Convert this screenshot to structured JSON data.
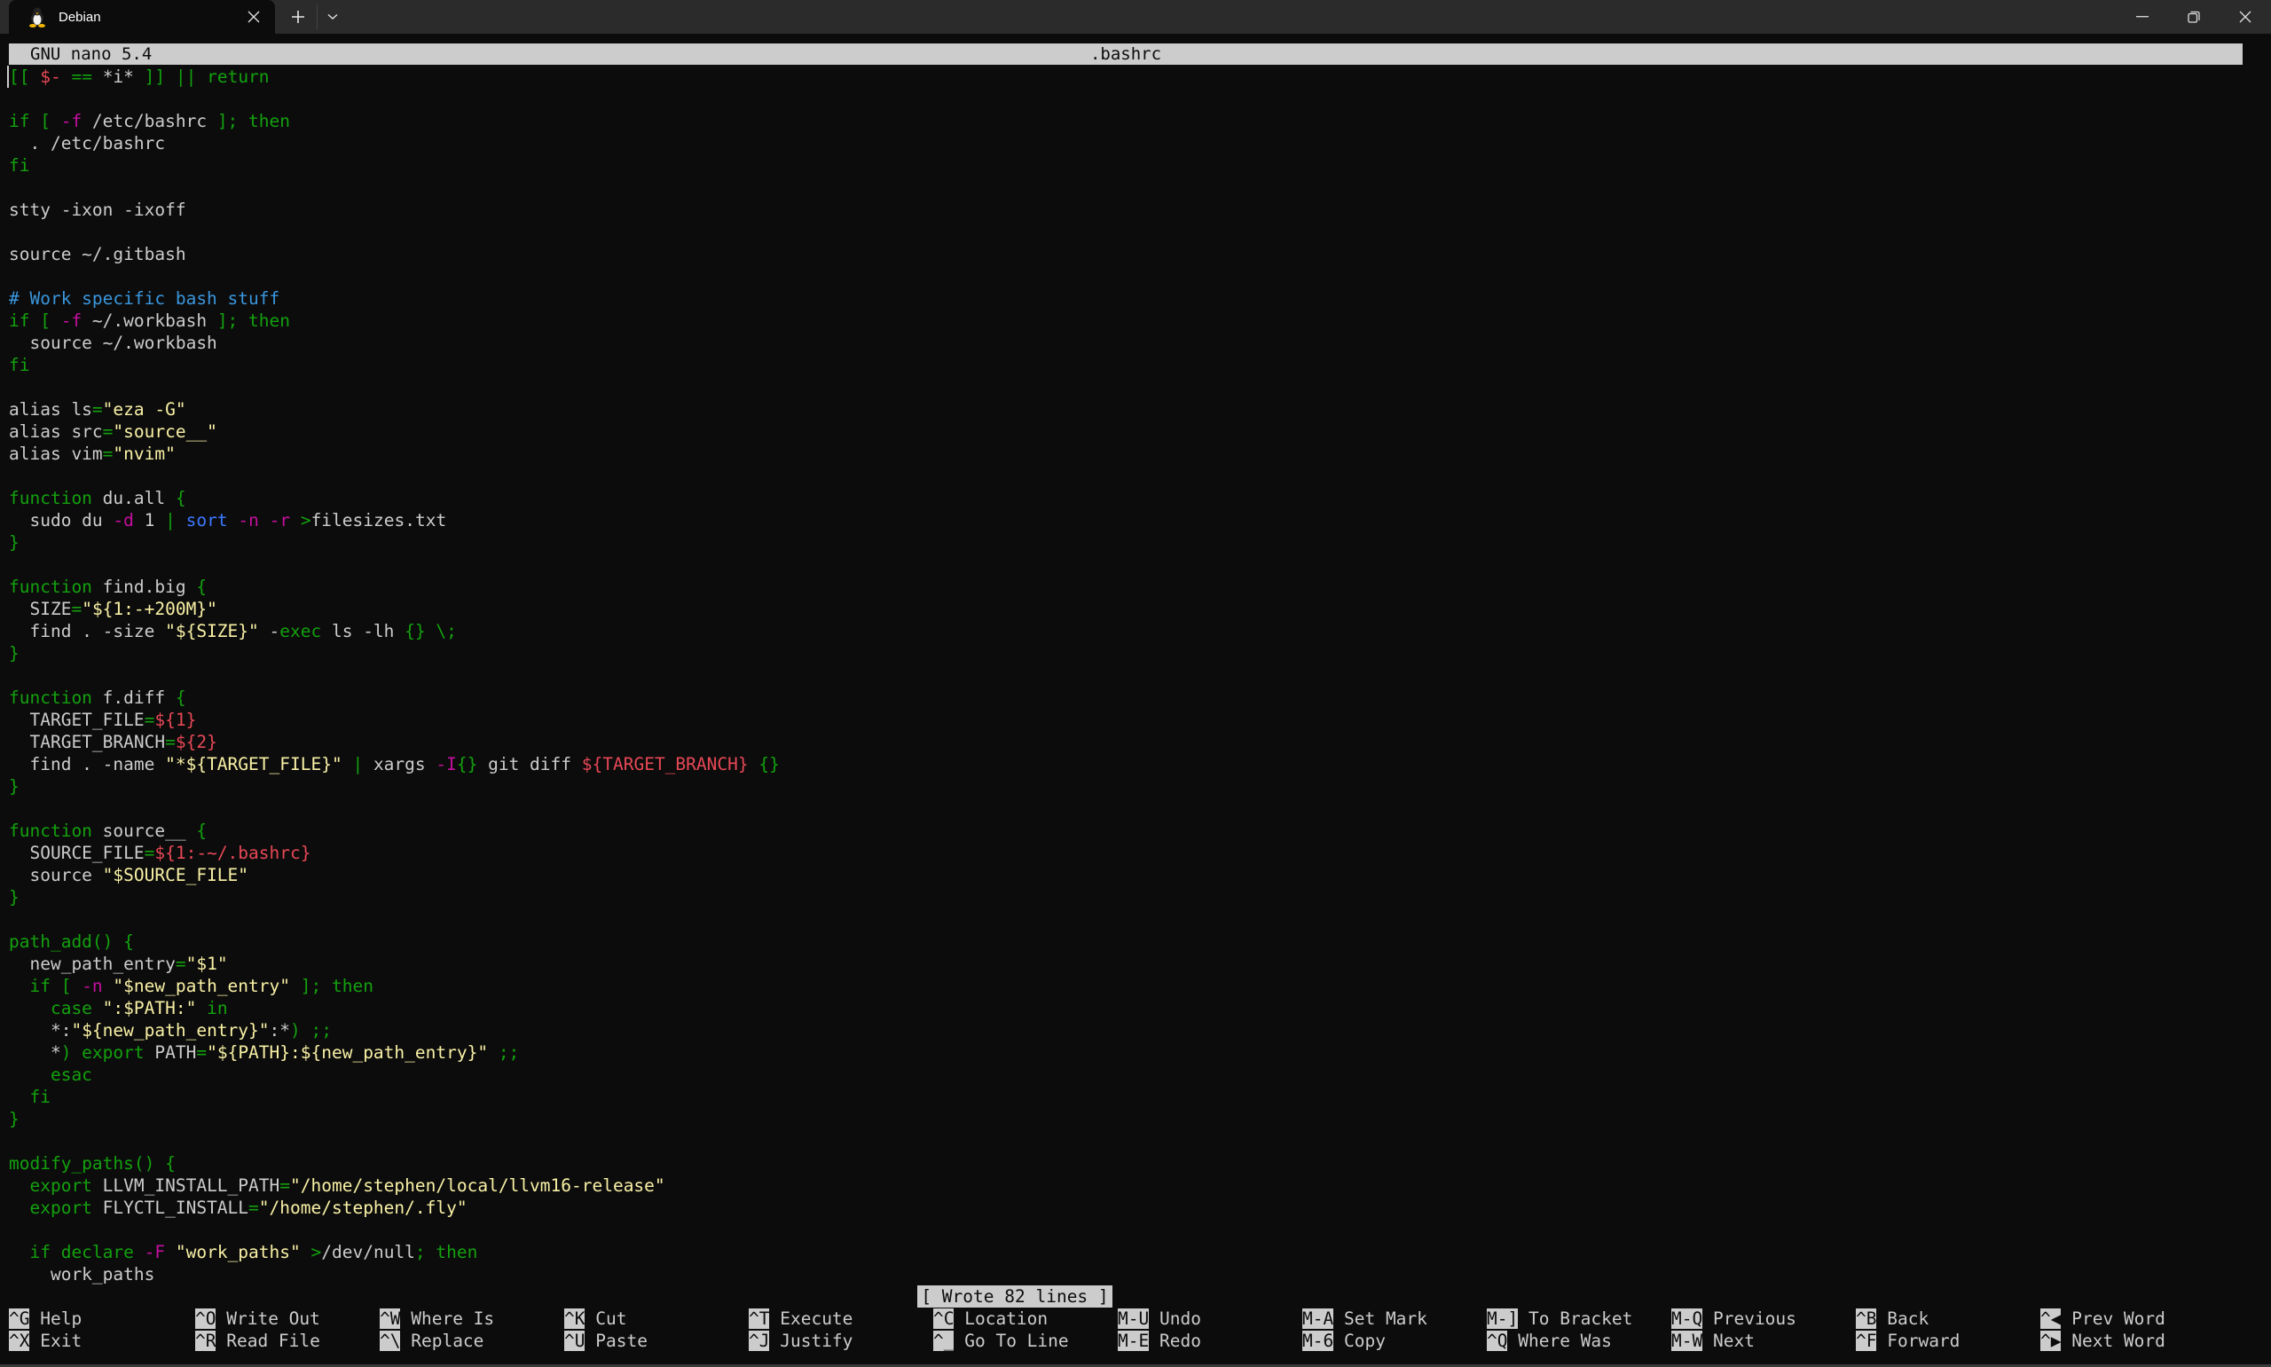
{
  "window": {
    "tab_title": "Debian",
    "tab_icon": "tux-penguin-icon",
    "new_tab_label": "+",
    "dropdown_label": "⌄",
    "controls": [
      "minimize",
      "maximize",
      "close"
    ]
  },
  "nano": {
    "version": "GNU nano 5.4",
    "filename": ".bashrc",
    "status_message": "[ Wrote 82 lines ]"
  },
  "code_lines": [
    [
      [
        "kw",
        "[[ "
      ],
      [
        "var",
        "$-"
      ],
      [
        "kw",
        " == "
      ],
      [
        "plain",
        "*i*"
      ],
      [
        "kw",
        " ]] || return"
      ]
    ],
    [],
    [
      [
        "kw",
        "if [ "
      ],
      [
        "op",
        "-f"
      ],
      [
        "plain",
        " /etc/bashrc "
      ],
      [
        "kw",
        "]; then"
      ]
    ],
    [
      [
        "plain",
        "  . /etc/bashrc"
      ]
    ],
    [
      [
        "kw",
        "fi"
      ]
    ],
    [],
    [
      [
        "plain",
        "stty -ixon -ixoff"
      ]
    ],
    [],
    [
      [
        "plain",
        "source ~/.gitbash"
      ]
    ],
    [],
    [
      [
        "cmt",
        "# Work specific bash stuff"
      ]
    ],
    [
      [
        "kw",
        "if [ "
      ],
      [
        "op",
        "-f"
      ],
      [
        "plain",
        " ~/.workbash "
      ],
      [
        "kw",
        "]; then"
      ]
    ],
    [
      [
        "plain",
        "  source ~/.workbash"
      ]
    ],
    [
      [
        "kw",
        "fi"
      ]
    ],
    [],
    [
      [
        "plain",
        "alias ls"
      ],
      [
        "kw",
        "="
      ],
      [
        "str",
        "\"eza -G\""
      ]
    ],
    [
      [
        "plain",
        "alias src"
      ],
      [
        "kw",
        "="
      ],
      [
        "str",
        "\"source__\""
      ]
    ],
    [
      [
        "plain",
        "alias vim"
      ],
      [
        "kw",
        "="
      ],
      [
        "str",
        "\"nvim\""
      ]
    ],
    [],
    [
      [
        "kw",
        "function"
      ],
      [
        "plain",
        " du.all "
      ],
      [
        "kw",
        "{"
      ]
    ],
    [
      [
        "plain",
        "  sudo du "
      ],
      [
        "op",
        "-d"
      ],
      [
        "plain",
        " 1 "
      ],
      [
        "kw",
        "|"
      ],
      [
        "plain",
        " "
      ],
      [
        "cmd",
        "sort"
      ],
      [
        "plain",
        " "
      ],
      [
        "op",
        "-n"
      ],
      [
        "plain",
        " "
      ],
      [
        "op",
        "-r"
      ],
      [
        "plain",
        " "
      ],
      [
        "kw",
        ">"
      ],
      [
        "plain",
        "filesizes.txt"
      ]
    ],
    [
      [
        "kw",
        "}"
      ]
    ],
    [],
    [
      [
        "kw",
        "function"
      ],
      [
        "plain",
        " find.big "
      ],
      [
        "kw",
        "{"
      ]
    ],
    [
      [
        "plain",
        "  SIZE"
      ],
      [
        "kw",
        "="
      ],
      [
        "str",
        "\"${1:-+200M}\""
      ]
    ],
    [
      [
        "plain",
        "  find . -size "
      ],
      [
        "str",
        "\"${SIZE}\""
      ],
      [
        "plain",
        " -"
      ],
      [
        "kw",
        "exec"
      ],
      [
        "plain",
        " ls -lh "
      ],
      [
        "kw",
        "{}"
      ],
      [
        "plain",
        " "
      ],
      [
        "kw",
        "\\;"
      ]
    ],
    [
      [
        "kw",
        "}"
      ]
    ],
    [],
    [
      [
        "kw",
        "function"
      ],
      [
        "plain",
        " f.diff "
      ],
      [
        "kw",
        "{"
      ]
    ],
    [
      [
        "plain",
        "  TARGET_FILE"
      ],
      [
        "kw",
        "="
      ],
      [
        "var",
        "${1}"
      ]
    ],
    [
      [
        "plain",
        "  TARGET_BRANCH"
      ],
      [
        "kw",
        "="
      ],
      [
        "var",
        "${2}"
      ]
    ],
    [
      [
        "plain",
        "  find . -name "
      ],
      [
        "str",
        "\"*${TARGET_FILE}\""
      ],
      [
        "plain",
        " "
      ],
      [
        "kw",
        "|"
      ],
      [
        "plain",
        " xargs "
      ],
      [
        "op",
        "-I"
      ],
      [
        "kw",
        "{}"
      ],
      [
        "plain",
        " git diff "
      ],
      [
        "var",
        "${TARGET_BRANCH}"
      ],
      [
        "plain",
        " "
      ],
      [
        "kw",
        "{}"
      ]
    ],
    [
      [
        "kw",
        "}"
      ]
    ],
    [],
    [
      [
        "kw",
        "function"
      ],
      [
        "plain",
        " source__ "
      ],
      [
        "kw",
        "{"
      ]
    ],
    [
      [
        "plain",
        "  SOURCE_FILE"
      ],
      [
        "kw",
        "="
      ],
      [
        "var",
        "${1:-~/.bashrc}"
      ]
    ],
    [
      [
        "plain",
        "  source "
      ],
      [
        "str",
        "\"$SOURCE_FILE\""
      ]
    ],
    [
      [
        "kw",
        "}"
      ]
    ],
    [],
    [
      [
        "kw",
        "path_add() {"
      ]
    ],
    [
      [
        "plain",
        "  new_path_entry"
      ],
      [
        "kw",
        "="
      ],
      [
        "str",
        "\"$1\""
      ]
    ],
    [
      [
        "kw",
        "  if [ "
      ],
      [
        "op",
        "-n"
      ],
      [
        "plain",
        " "
      ],
      [
        "str",
        "\"$new_path_entry\""
      ],
      [
        "kw",
        " ]; then"
      ]
    ],
    [
      [
        "kw",
        "    case "
      ],
      [
        "str",
        "\":$PATH:\""
      ],
      [
        "kw",
        " in"
      ]
    ],
    [
      [
        "plain",
        "    *:"
      ],
      [
        "str",
        "\"${new_path_entry}\""
      ],
      [
        "plain",
        ":*"
      ],
      [
        "kw",
        ") ;;"
      ]
    ],
    [
      [
        "plain",
        "    *"
      ],
      [
        "kw",
        ") export "
      ],
      [
        "plain",
        "PATH"
      ],
      [
        "kw",
        "="
      ],
      [
        "str",
        "\"${PATH}:${new_path_entry}\""
      ],
      [
        "kw",
        " ;;"
      ]
    ],
    [
      [
        "kw",
        "    esac"
      ]
    ],
    [
      [
        "kw",
        "  fi"
      ]
    ],
    [
      [
        "kw",
        "}"
      ]
    ],
    [],
    [
      [
        "kw",
        "modify_paths() {"
      ]
    ],
    [
      [
        "kw",
        "  export "
      ],
      [
        "plain",
        "LLVM_INSTALL_PATH"
      ],
      [
        "kw",
        "="
      ],
      [
        "str",
        "\"/home/stephen/local/llvm16-release\""
      ]
    ],
    [
      [
        "kw",
        "  export "
      ],
      [
        "plain",
        "FLYCTL_INSTALL"
      ],
      [
        "kw",
        "="
      ],
      [
        "str",
        "\"/home/stephen/.fly\""
      ]
    ],
    [],
    [
      [
        "kw",
        "  if declare "
      ],
      [
        "op",
        "-F"
      ],
      [
        "plain",
        " "
      ],
      [
        "str",
        "\"work_paths\""
      ],
      [
        "plain",
        " "
      ],
      [
        "kw",
        ">"
      ],
      [
        "plain",
        "/dev/null"
      ],
      [
        "kw",
        "; then"
      ]
    ],
    [
      [
        "plain",
        "    work_paths"
      ]
    ]
  ],
  "shortcuts": [
    [
      {
        "key": "^G",
        "label": "Help"
      },
      {
        "key": "^X",
        "label": "Exit"
      }
    ],
    [
      {
        "key": "^O",
        "label": "Write Out"
      },
      {
        "key": "^R",
        "label": "Read File"
      }
    ],
    [
      {
        "key": "^W",
        "label": "Where Is"
      },
      {
        "key": "^\\",
        "label": "Replace"
      }
    ],
    [
      {
        "key": "^K",
        "label": "Cut"
      },
      {
        "key": "^U",
        "label": "Paste"
      }
    ],
    [
      {
        "key": "^T",
        "label": "Execute"
      },
      {
        "key": "^J",
        "label": "Justify"
      }
    ],
    [
      {
        "key": "^C",
        "label": "Location"
      },
      {
        "key": "^_",
        "label": "Go To Line"
      }
    ],
    [
      {
        "key": "M-U",
        "label": "Undo"
      },
      {
        "key": "M-E",
        "label": "Redo"
      }
    ],
    [
      {
        "key": "M-A",
        "label": "Set Mark"
      },
      {
        "key": "M-6",
        "label": "Copy"
      }
    ],
    [
      {
        "key": "M-]",
        "label": "To Bracket"
      },
      {
        "key": "^Q",
        "label": "Where Was"
      }
    ],
    [
      {
        "key": "M-Q",
        "label": "Previous"
      },
      {
        "key": "M-W",
        "label": "Next"
      }
    ],
    [
      {
        "key": "^B",
        "label": "Back"
      },
      {
        "key": "^F",
        "label": "Forward"
      }
    ],
    [
      {
        "key": "^◀",
        "label": "Prev Word"
      },
      {
        "key": "^▶",
        "label": "Next Word"
      }
    ]
  ],
  "colors": {
    "background": "#0c0c0c",
    "foreground": "#cccccc",
    "keyword_green": "#13a10e",
    "option_magenta": "#c50f9f",
    "variable_red": "#e74856",
    "string_yellow": "#f9f1a5",
    "comment_blue": "#3a96dd",
    "command_blue": "#3b78ff",
    "highlight_bar": "#cccccc"
  }
}
